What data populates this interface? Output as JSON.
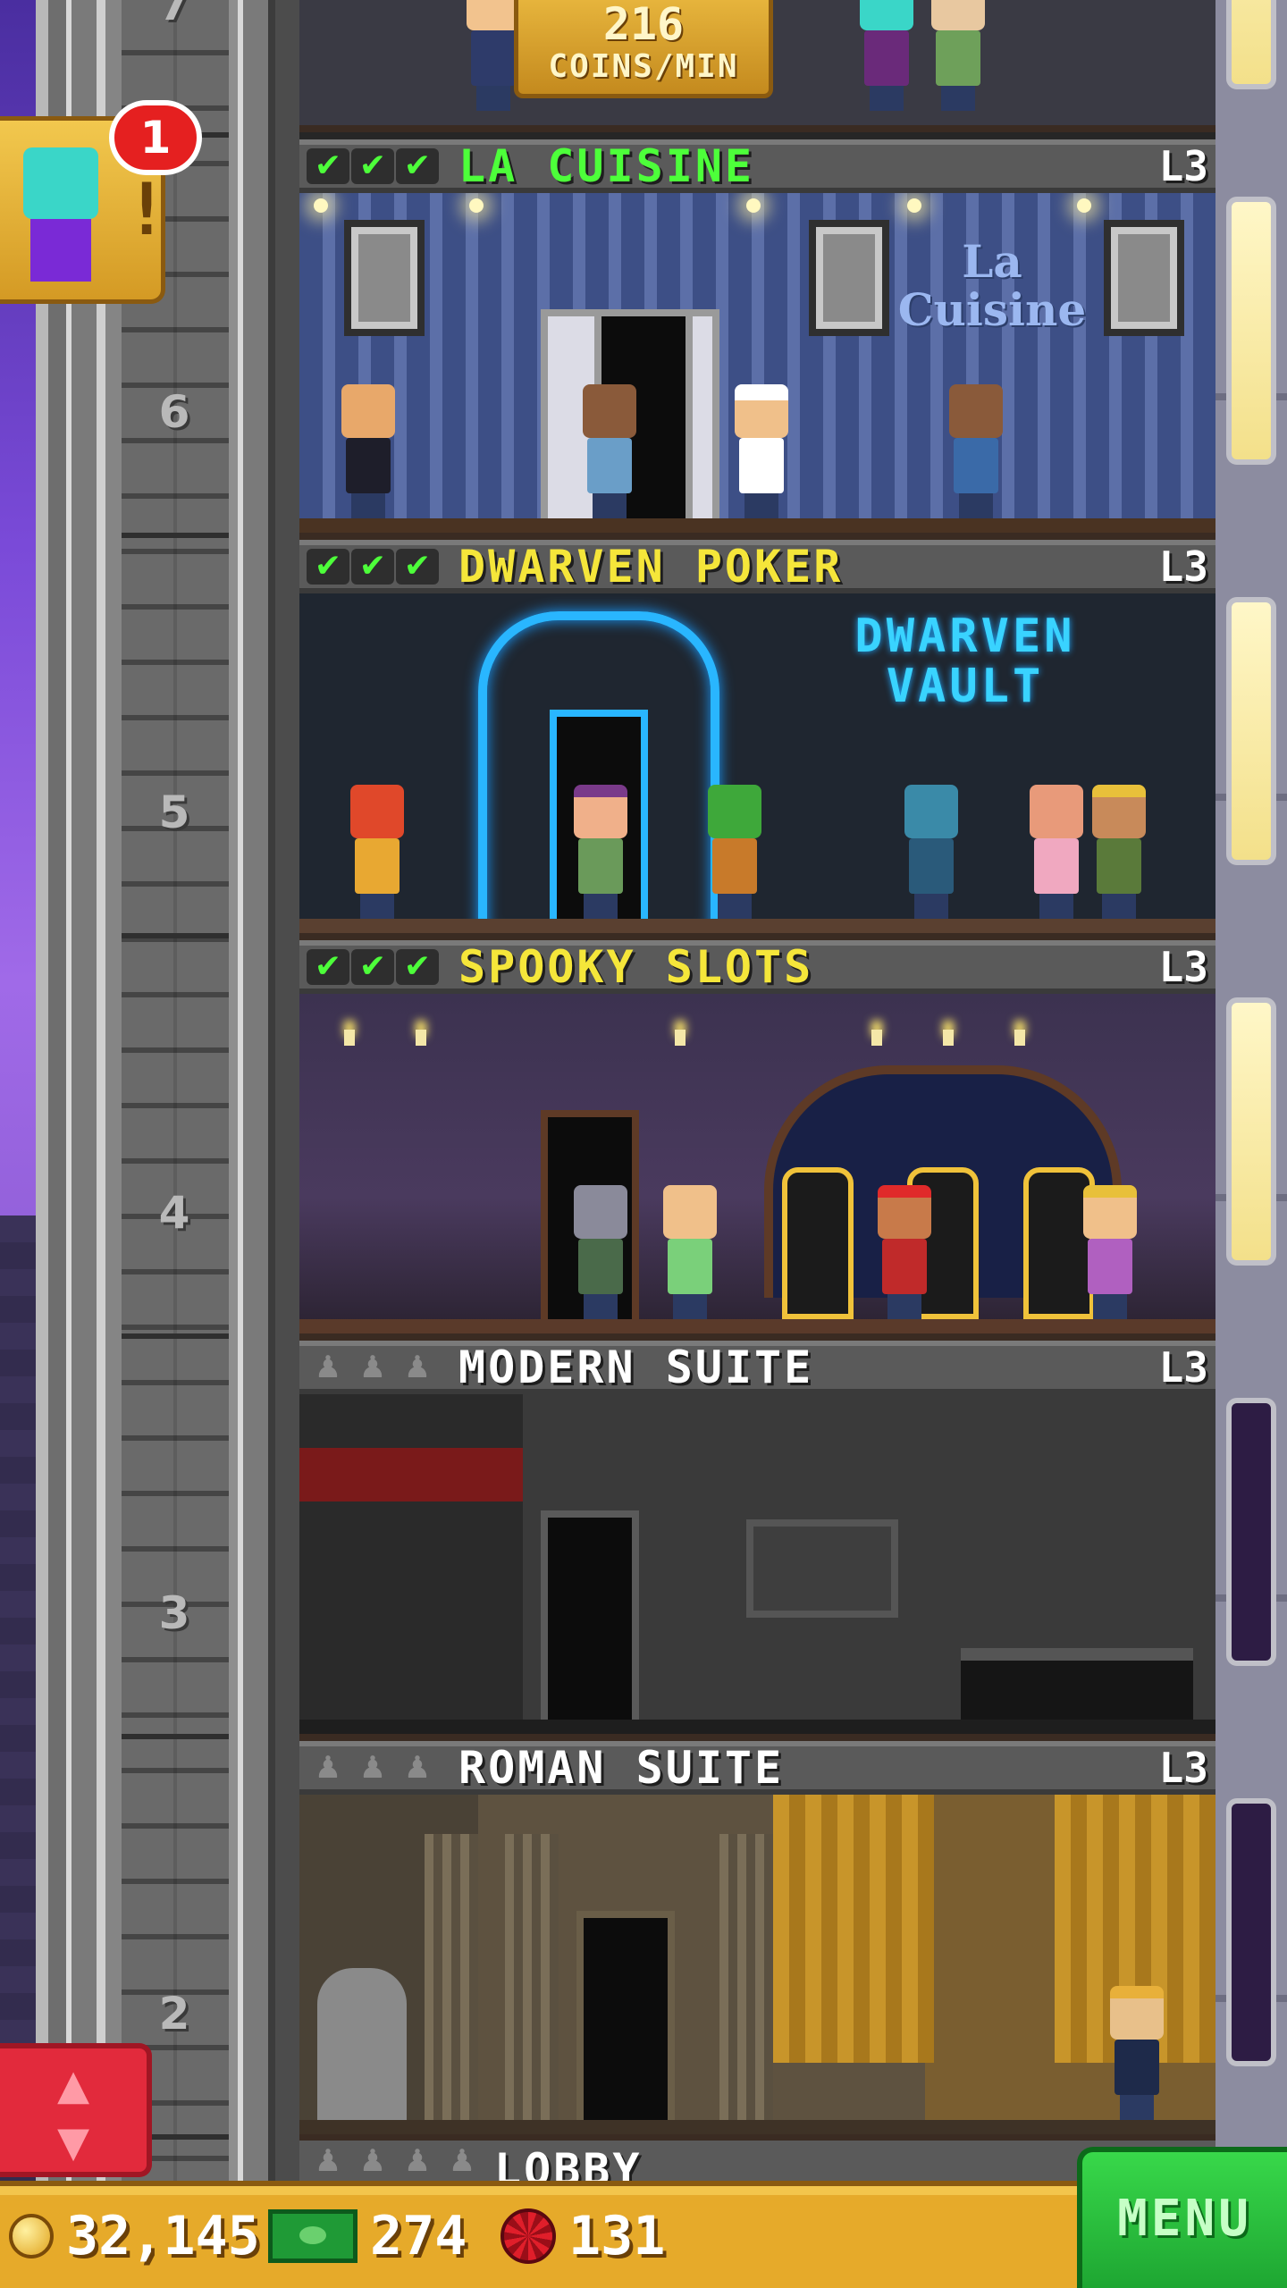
{
  "coins_per_min": {
    "amount": "216",
    "unit": "COINS/MIN"
  },
  "notification": {
    "badge_count": "1",
    "icon": "bitizen-alert-icon"
  },
  "elevator": {
    "floor_numbers": [
      "7",
      "6",
      "5",
      "4",
      "3",
      "2"
    ],
    "button_icon": "elevator-up-down-icon"
  },
  "floors": [
    {
      "name": "LA CUISINE",
      "level": "L3",
      "stocked": true,
      "name_color": "#4dff3a",
      "sign": "La Cuisine"
    },
    {
      "name": "DWARVEN POKER",
      "level": "L3",
      "stocked": true,
      "name_color": "#f5e63a",
      "sign_line1": "DWARVEN",
      "sign_line2": "VAULT"
    },
    {
      "name": "SPOOKY SLOTS",
      "level": "L3",
      "stocked": true,
      "name_color": "#f5e63a"
    },
    {
      "name": "MODERN SUITE",
      "level": "L3",
      "stocked": false,
      "name_color": "#ffffff"
    },
    {
      "name": "ROMAN SUITE",
      "level": "L3",
      "stocked": false,
      "name_color": "#ffffff"
    }
  ],
  "lobby": {
    "name": "LOBBY"
  },
  "bottom_bar": {
    "coins": "32,145",
    "bux_cash": "274",
    "chips": "131",
    "menu_label": "MENU"
  },
  "colors": {
    "accent_gold": "#e6aa2a",
    "menu_green": "#1ea632",
    "alert_red": "#e52020"
  }
}
